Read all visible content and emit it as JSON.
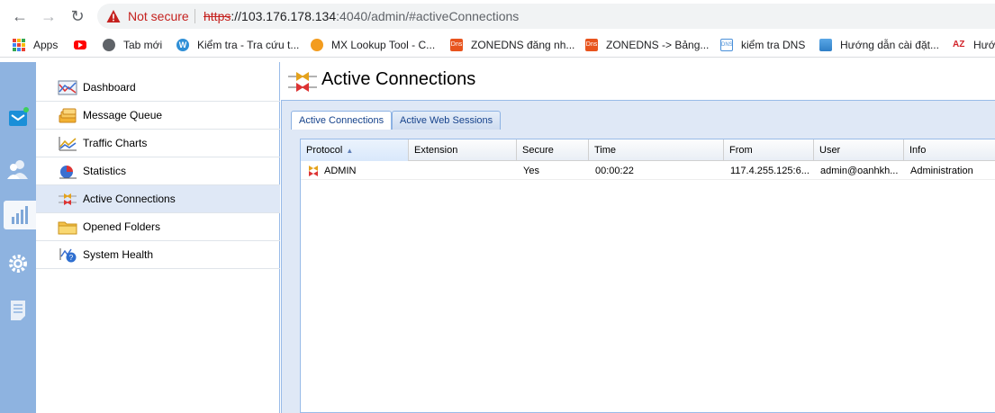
{
  "browser": {
    "security_label": "Not secure",
    "url_scheme": "https",
    "url_host": "://103.176.178.134",
    "url_path": ":4040/admin/#activeConnections"
  },
  "bookmarks": [
    {
      "label": "Apps",
      "icon": "apps-grid-icon"
    },
    {
      "label": "",
      "icon": "youtube-icon"
    },
    {
      "label": "Tab mới",
      "icon": "globe-icon"
    },
    {
      "label": "Kiểm tra - Tra cứu t...",
      "icon": "w-icon"
    },
    {
      "label": "MX Lookup Tool - C...",
      "icon": "mxtoolbox-icon"
    },
    {
      "label": "ZONEDNS đăng nh...",
      "icon": "dns-icon"
    },
    {
      "label": "ZONEDNS -> Bảng...",
      "icon": "dns-icon"
    },
    {
      "label": "kiểm tra DNS",
      "icon": "dns-check-icon"
    },
    {
      "label": "Hướng dẫn cài đặt...",
      "icon": "stack-icon"
    },
    {
      "label": "Hướ",
      "icon": "az-icon"
    }
  ],
  "menu": {
    "items": [
      {
        "label": "Dashboard",
        "icon": "dashboard-icon"
      },
      {
        "label": "Message Queue",
        "icon": "message-queue-icon"
      },
      {
        "label": "Traffic Charts",
        "icon": "traffic-chart-icon"
      },
      {
        "label": "Statistics",
        "icon": "statistics-icon"
      },
      {
        "label": "Active Connections",
        "icon": "connections-icon",
        "selected": true
      },
      {
        "label": "Opened Folders",
        "icon": "folder-icon"
      },
      {
        "label": "System Health",
        "icon": "system-health-icon"
      }
    ]
  },
  "page": {
    "title": "Active Connections"
  },
  "tabs": [
    {
      "label": "Active Connections",
      "active": true
    },
    {
      "label": "Active Web Sessions",
      "active": false
    }
  ],
  "grid": {
    "columns": [
      "Protocol",
      "Extension",
      "Secure",
      "Time",
      "From",
      "User",
      "Info"
    ],
    "sorted_column": "Protocol",
    "rows": [
      {
        "protocol": "ADMIN",
        "extension": "",
        "secure": "Yes",
        "time": "00:00:22",
        "from": "117.4.255.125:6...",
        "user": "admin@oanhkh...",
        "info": "Administration"
      }
    ]
  },
  "colors": {
    "accent": "#99bbe8",
    "iconbar": "#8eb3e0",
    "selected": "#dfe8f6",
    "not_secure": "#c5221f"
  }
}
